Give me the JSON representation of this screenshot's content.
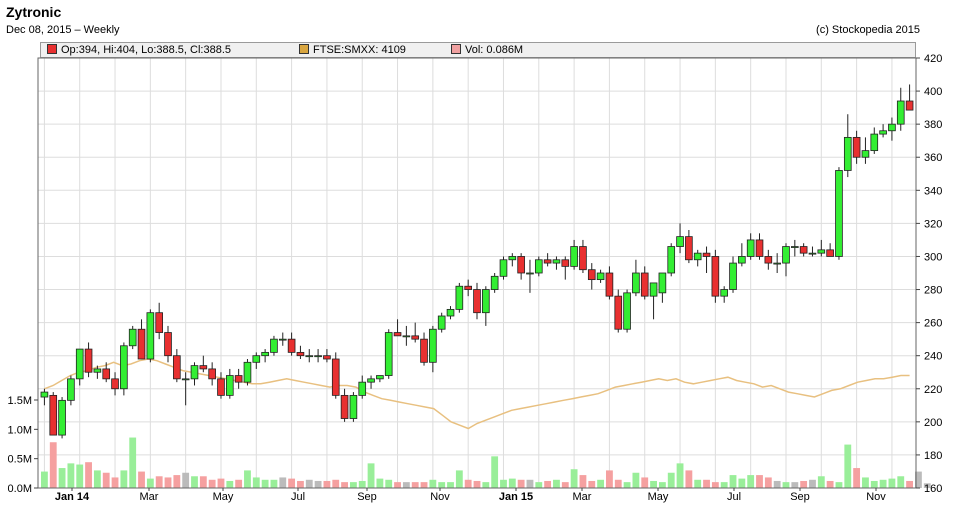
{
  "header": {
    "title": "Zytronic",
    "subtitle": "Dec 08, 2015 – Weekly",
    "copyright": "(c) Stockopedia 2015"
  },
  "legend": [
    {
      "label": "Op:394, Hi:404, Lo:388.5, Cl:388.5",
      "color": "#e83030"
    },
    {
      "label": "FTSE:SMXX: 4109",
      "color": "#d9a640"
    },
    {
      "label": "Vol: 0.086M",
      "color": "#f0a0a0"
    }
  ],
  "colors": {
    "up": "#33ee33",
    "down": "#e83030",
    "index_line": "#e8c080",
    "vol_up": "#99ee99",
    "vol_down": "#f5a0a0",
    "vol_flat": "#bbbbbb",
    "grid": "#dddddd"
  },
  "chart_data": {
    "type": "candlestick",
    "x_labels": [
      "Jan 14",
      "Mar",
      "May",
      "Jul",
      "Sep",
      "Nov",
      "Jan 15",
      "Mar",
      "May",
      "Jul",
      "Sep",
      "Nov"
    ],
    "x_bold": [
      true,
      false,
      false,
      false,
      false,
      false,
      true,
      false,
      false,
      false,
      false,
      false
    ],
    "price_axis": {
      "min": 160,
      "max": 420,
      "ticks": [
        160,
        180,
        200,
        220,
        240,
        260,
        280,
        300,
        320,
        340,
        360,
        380,
        400,
        420
      ],
      "side": "right"
    },
    "volume_axis": {
      "min": 0,
      "max": 1.5,
      "ticks": [
        "0.0M",
        "0.5M",
        "1.0M",
        "1.5M"
      ],
      "tick_values": [
        0,
        0.5,
        1.0,
        1.5
      ],
      "side": "left"
    },
    "candles": [
      {
        "o": 215,
        "h": 220,
        "l": 210,
        "c": 218
      },
      {
        "o": 216,
        "h": 218,
        "l": 200,
        "c": 192
      },
      {
        "o": 192,
        "h": 215,
        "l": 190,
        "c": 213
      },
      {
        "o": 213,
        "h": 228,
        "l": 210,
        "c": 226
      },
      {
        "o": 226,
        "h": 232,
        "l": 222,
        "c": 244
      },
      {
        "o": 244,
        "h": 248,
        "l": 227,
        "c": 230
      },
      {
        "o": 230,
        "h": 234,
        "l": 226,
        "c": 232
      },
      {
        "o": 232,
        "h": 236,
        "l": 224,
        "c": 226
      },
      {
        "o": 226,
        "h": 230,
        "l": 216,
        "c": 220
      },
      {
        "o": 220,
        "h": 248,
        "l": 216,
        "c": 246
      },
      {
        "o": 246,
        "h": 258,
        "l": 244,
        "c": 256
      },
      {
        "o": 256,
        "h": 262,
        "l": 240,
        "c": 238
      },
      {
        "o": 238,
        "h": 268,
        "l": 236,
        "c": 266
      },
      {
        "o": 266,
        "h": 272,
        "l": 250,
        "c": 254
      },
      {
        "o": 254,
        "h": 258,
        "l": 236,
        "c": 240
      },
      {
        "o": 240,
        "h": 244,
        "l": 224,
        "c": 226
      },
      {
        "o": 226,
        "h": 230,
        "l": 210,
        "c": 226
      },
      {
        "o": 226,
        "h": 236,
        "l": 222,
        "c": 234
      },
      {
        "o": 234,
        "h": 240,
        "l": 230,
        "c": 232
      },
      {
        "o": 232,
        "h": 236,
        "l": 222,
        "c": 226
      },
      {
        "o": 226,
        "h": 230,
        "l": 214,
        "c": 216
      },
      {
        "o": 216,
        "h": 232,
        "l": 214,
        "c": 228
      },
      {
        "o": 228,
        "h": 232,
        "l": 220,
        "c": 224
      },
      {
        "o": 224,
        "h": 238,
        "l": 222,
        "c": 236
      },
      {
        "o": 236,
        "h": 242,
        "l": 232,
        "c": 240
      },
      {
        "o": 240,
        "h": 244,
        "l": 236,
        "c": 242
      },
      {
        "o": 242,
        "h": 252,
        "l": 240,
        "c": 250
      },
      {
        "o": 250,
        "h": 254,
        "l": 246,
        "c": 250
      },
      {
        "o": 250,
        "h": 254,
        "l": 240,
        "c": 242
      },
      {
        "o": 242,
        "h": 246,
        "l": 238,
        "c": 240
      },
      {
        "o": 240,
        "h": 244,
        "l": 236,
        "c": 240
      },
      {
        "o": 240,
        "h": 244,
        "l": 236,
        "c": 240
      },
      {
        "o": 240,
        "h": 244,
        "l": 236,
        "c": 238
      },
      {
        "o": 238,
        "h": 242,
        "l": 214,
        "c": 216
      },
      {
        "o": 216,
        "h": 220,
        "l": 200,
        "c": 202
      },
      {
        "o": 202,
        "h": 218,
        "l": 200,
        "c": 216
      },
      {
        "o": 216,
        "h": 228,
        "l": 214,
        "c": 224
      },
      {
        "o": 224,
        "h": 228,
        "l": 220,
        "c": 226
      },
      {
        "o": 226,
        "h": 228,
        "l": 224,
        "c": 228
      },
      {
        "o": 228,
        "h": 256,
        "l": 226,
        "c": 254
      },
      {
        "o": 254,
        "h": 262,
        "l": 252,
        "c": 252
      },
      {
        "o": 252,
        "h": 258,
        "l": 246,
        "c": 252
      },
      {
        "o": 252,
        "h": 260,
        "l": 248,
        "c": 250
      },
      {
        "o": 250,
        "h": 254,
        "l": 234,
        "c": 236
      },
      {
        "o": 236,
        "h": 258,
        "l": 230,
        "c": 256
      },
      {
        "o": 256,
        "h": 266,
        "l": 254,
        "c": 264
      },
      {
        "o": 264,
        "h": 270,
        "l": 262,
        "c": 268
      },
      {
        "o": 268,
        "h": 284,
        "l": 266,
        "c": 282
      },
      {
        "o": 282,
        "h": 286,
        "l": 276,
        "c": 280
      },
      {
        "o": 280,
        "h": 284,
        "l": 262,
        "c": 266
      },
      {
        "o": 266,
        "h": 282,
        "l": 258,
        "c": 280
      },
      {
        "o": 280,
        "h": 290,
        "l": 278,
        "c": 288
      },
      {
        "o": 288,
        "h": 300,
        "l": 286,
        "c": 298
      },
      {
        "o": 298,
        "h": 302,
        "l": 294,
        "c": 300
      },
      {
        "o": 300,
        "h": 302,
        "l": 286,
        "c": 290
      },
      {
        "o": 290,
        "h": 298,
        "l": 278,
        "c": 290
      },
      {
        "o": 290,
        "h": 300,
        "l": 288,
        "c": 298
      },
      {
        "o": 298,
        "h": 302,
        "l": 294,
        "c": 296
      },
      {
        "o": 296,
        "h": 300,
        "l": 292,
        "c": 298
      },
      {
        "o": 298,
        "h": 300,
        "l": 286,
        "c": 294
      },
      {
        "o": 294,
        "h": 310,
        "l": 292,
        "c": 306
      },
      {
        "o": 306,
        "h": 310,
        "l": 290,
        "c": 292
      },
      {
        "o": 292,
        "h": 296,
        "l": 280,
        "c": 286
      },
      {
        "o": 286,
        "h": 292,
        "l": 284,
        "c": 290
      },
      {
        "o": 290,
        "h": 294,
        "l": 274,
        "c": 276
      },
      {
        "o": 276,
        "h": 280,
        "l": 254,
        "c": 256
      },
      {
        "o": 256,
        "h": 280,
        "l": 254,
        "c": 278
      },
      {
        "o": 278,
        "h": 298,
        "l": 276,
        "c": 290
      },
      {
        "o": 290,
        "h": 294,
        "l": 274,
        "c": 276
      },
      {
        "o": 276,
        "h": 282,
        "l": 262,
        "c": 284
      },
      {
        "o": 278,
        "h": 290,
        "l": 272,
        "c": 290
      },
      {
        "o": 290,
        "h": 308,
        "l": 288,
        "c": 306
      },
      {
        "o": 306,
        "h": 320,
        "l": 302,
        "c": 312
      },
      {
        "o": 312,
        "h": 316,
        "l": 296,
        "c": 298
      },
      {
        "o": 298,
        "h": 304,
        "l": 294,
        "c": 302
      },
      {
        "o": 302,
        "h": 306,
        "l": 290,
        "c": 300
      },
      {
        "o": 300,
        "h": 304,
        "l": 272,
        "c": 276
      },
      {
        "o": 276,
        "h": 282,
        "l": 272,
        "c": 280
      },
      {
        "o": 280,
        "h": 300,
        "l": 278,
        "c": 296
      },
      {
        "o": 296,
        "h": 308,
        "l": 294,
        "c": 300
      },
      {
        "o": 300,
        "h": 314,
        "l": 298,
        "c": 310
      },
      {
        "o": 310,
        "h": 314,
        "l": 298,
        "c": 300
      },
      {
        "o": 300,
        "h": 304,
        "l": 292,
        "c": 296
      },
      {
        "o": 296,
        "h": 302,
        "l": 290,
        "c": 296
      },
      {
        "o": 296,
        "h": 308,
        "l": 288,
        "c": 306
      },
      {
        "o": 306,
        "h": 310,
        "l": 300,
        "c": 306
      },
      {
        "o": 306,
        "h": 308,
        "l": 300,
        "c": 302
      },
      {
        "o": 302,
        "h": 306,
        "l": 300,
        "c": 302
      },
      {
        "o": 302,
        "h": 310,
        "l": 300,
        "c": 304
      },
      {
        "o": 304,
        "h": 308,
        "l": 300,
        "c": 300
      },
      {
        "o": 300,
        "h": 354,
        "l": 298,
        "c": 352
      },
      {
        "o": 352,
        "h": 386,
        "l": 348,
        "c": 372
      },
      {
        "o": 372,
        "h": 376,
        "l": 356,
        "c": 360
      },
      {
        "o": 360,
        "h": 372,
        "l": 356,
        "c": 364
      },
      {
        "o": 364,
        "h": 378,
        "l": 362,
        "c": 374
      },
      {
        "o": 374,
        "h": 380,
        "l": 372,
        "c": 376
      },
      {
        "o": 376,
        "h": 384,
        "l": 370,
        "c": 380
      },
      {
        "o": 380,
        "h": 402,
        "l": 376,
        "c": 394
      },
      {
        "o": 394,
        "h": 404,
        "l": 388.5,
        "c": 388.5
      }
    ],
    "index_line": [
      220,
      222,
      225,
      228,
      230,
      231,
      233,
      234,
      236,
      234,
      235,
      237,
      238,
      237,
      235,
      233,
      231,
      230,
      229,
      228,
      227,
      226,
      225,
      224,
      223,
      223,
      224,
      225,
      226,
      225,
      224,
      223,
      222,
      221,
      222,
      222,
      221,
      218,
      216,
      214,
      213,
      212,
      211,
      210,
      209,
      208,
      204,
      200,
      198,
      196,
      199,
      201,
      203,
      205,
      207,
      208,
      209,
      210,
      211,
      212,
      213,
      214,
      215,
      216,
      217,
      219,
      221,
      222,
      223,
      224,
      225,
      226,
      225,
      226,
      224,
      223,
      224,
      225,
      226,
      227,
      225,
      224,
      223,
      221,
      222,
      220,
      218,
      217,
      216,
      215,
      217,
      219,
      220,
      222,
      224,
      225,
      226,
      226,
      227,
      228,
      228
    ],
    "volume": [
      0.28,
      0.78,
      0.34,
      0.42,
      0.4,
      0.44,
      0.3,
      0.26,
      0.18,
      0.3,
      0.86,
      0.28,
      0.16,
      0.2,
      0.18,
      0.22,
      0.26,
      0.2,
      0.2,
      0.14,
      0.16,
      0.12,
      0.14,
      0.3,
      0.18,
      0.14,
      0.14,
      0.18,
      0.16,
      0.12,
      0.14,
      0.12,
      0.12,
      0.14,
      0.1,
      0.1,
      0.12,
      0.42,
      0.16,
      0.14,
      0.1,
      0.1,
      0.1,
      0.1,
      0.14,
      0.1,
      0.1,
      0.3,
      0.14,
      0.12,
      0.1,
      0.54,
      0.14,
      0.16,
      0.14,
      0.14,
      0.1,
      0.12,
      0.14,
      0.1,
      0.32,
      0.22,
      0.12,
      0.14,
      0.3,
      0.14,
      0.1,
      0.26,
      0.18,
      0.12,
      0.1,
      0.26,
      0.42,
      0.3,
      0.14,
      0.14,
      0.1,
      0.1,
      0.22,
      0.16,
      0.22,
      0.22,
      0.18,
      0.12,
      0.1,
      0.1,
      0.12,
      0.14,
      0.2,
      0.12,
      0.1,
      0.74,
      0.34,
      0.18,
      0.12,
      0.14,
      0.16,
      0.2,
      0.12,
      0.28,
      0.08
    ]
  }
}
